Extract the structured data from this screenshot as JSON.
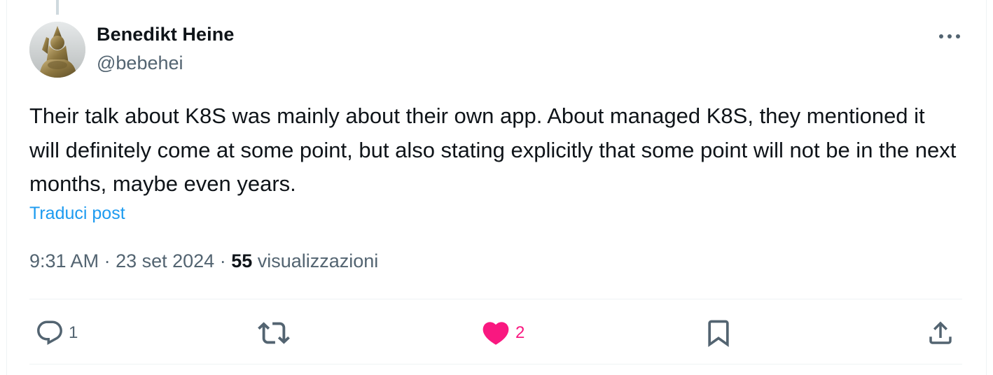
{
  "author": {
    "name": "Benedikt Heine",
    "handle": "@bebehei"
  },
  "tweet": {
    "text": "Their talk about K8S was mainly about their own app. About managed K8S, they mentioned it will definitely come at some point, but also stating explicitly that some point will not be in the next months, maybe even years.",
    "translate_label": "Traduci post"
  },
  "meta": {
    "time": "9:31 AM",
    "separator": " · ",
    "date": "23 set 2024",
    "views_count": "55",
    "views_label": " visualizzazioni"
  },
  "actions": {
    "reply": {
      "icon": "reply-icon",
      "count": "1"
    },
    "retweet": {
      "icon": "retweet-icon",
      "count": ""
    },
    "like": {
      "icon": "heart-icon",
      "count": "2",
      "color": "#f91880"
    },
    "bookmark": {
      "icon": "bookmark-icon"
    },
    "share": {
      "icon": "share-icon"
    }
  },
  "colors": {
    "link": "#1d9bf0",
    "secondary_text": "#536471",
    "primary_text": "#0f1419",
    "like": "#f91880"
  }
}
